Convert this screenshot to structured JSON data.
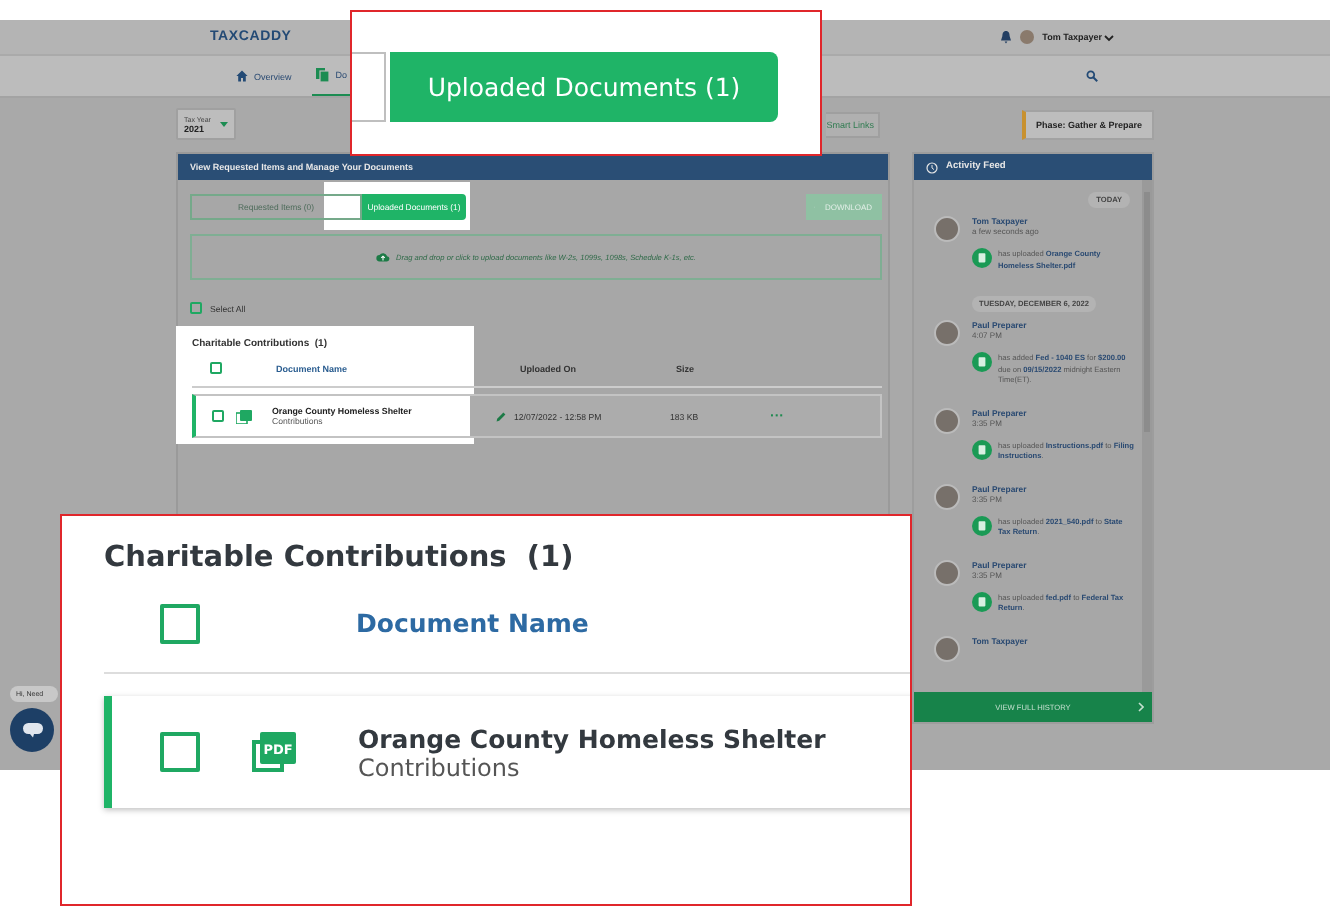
{
  "header": {
    "logo": "TAXCADDY",
    "user": "Tom Taxpayer"
  },
  "nav": [
    {
      "label": "Overview",
      "selected": false
    },
    {
      "label": "Do",
      "selected": true
    }
  ],
  "toolbar": {
    "tax_year_label": "Tax Year",
    "tax_year": "2021",
    "smart_links": "Smart Links",
    "phase": "Phase: Gather & Prepare"
  },
  "documents": {
    "title": "View Requested Items and Manage Your Documents",
    "tabs": [
      {
        "label": "Requested Items (0)",
        "selected": false
      },
      {
        "label": "Uploaded Documents (1)",
        "selected": true
      }
    ],
    "download": "DOWNLOAD",
    "dropzone": "Drag and drop or click to upload documents like W-2s, 1099s, 1098s, Schedule K-1s, etc.",
    "select_all": {
      "label": "Select All",
      "checked": false
    },
    "section": {
      "title": "Charitable Contributions",
      "count": "(1)",
      "header_checked": false,
      "columns": [
        "Document Name",
        "Uploaded On",
        "Size"
      ],
      "rows": [
        {
          "name": "Orange County Homeless Shelter",
          "category": "Contributions",
          "uploaded_on": "12/07/2022 - 12:58 PM",
          "size": "183 KB",
          "checked": false,
          "actions": "···"
        }
      ]
    }
  },
  "activity_feed": {
    "title": "Activity Feed",
    "footer": "VIEW FULL HISTORY",
    "groups": [
      {
        "date": "TODAY",
        "entries": [
          {
            "name": "Tom Taxpayer",
            "time": "a few seconds ago",
            "message": "has uploaded **Orange County Homeless Shelter.pdf**"
          }
        ]
      },
      {
        "date": "TUESDAY, DECEMBER 6, 2022",
        "entries": [
          {
            "name": "Paul Preparer",
            "time": "4:07 PM",
            "message": "has added **Fed - 1040 ES** for **$200.00** due on **09/15/2022** midnight Eastern Time(ET)."
          },
          {
            "name": "Paul Preparer",
            "time": "3:35 PM",
            "message": "has uploaded **Instructions.pdf** to **Filing Instructions**."
          },
          {
            "name": "Paul Preparer",
            "time": "3:35 PM",
            "message": "has uploaded **2021_540.pdf** to **State Tax Return**."
          },
          {
            "name": "Paul Preparer",
            "time": "3:35 PM",
            "message": "has uploaded **fed.pdf** to **Federal Tax Return**."
          },
          {
            "name": "Tom Taxpayer"
          }
        ]
      }
    ]
  },
  "chat": {
    "greeting": "Hi, Need"
  },
  "callouts": [
    {
      "kind": "tab",
      "label": "Uploaded Documents (1)"
    },
    {
      "kind": "section",
      "title": "Charitable Contributions",
      "count": "(1)",
      "header_checked": false,
      "column": "Document Name",
      "name": "Orange County Homeless Shelter",
      "category": "Contributions",
      "checked": false,
      "file_type": "PDF"
    }
  ]
}
